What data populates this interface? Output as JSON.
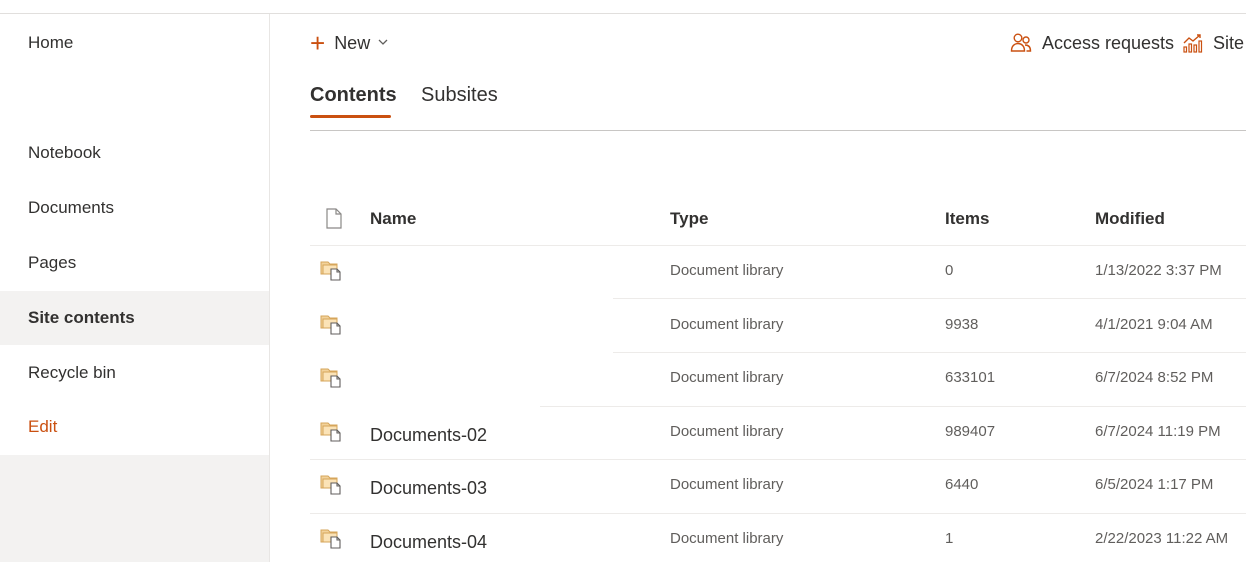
{
  "left_nav": {
    "items": [
      {
        "label": "Home"
      },
      {
        "label": "Notebook"
      },
      {
        "label": "Documents"
      },
      {
        "label": "Pages"
      },
      {
        "label": "Site contents"
      },
      {
        "label": "Recycle bin"
      },
      {
        "label": "Edit"
      }
    ]
  },
  "command_bar": {
    "new_label": "New",
    "access_requests_label": "Access requests",
    "site_label": "Site"
  },
  "tabs": [
    {
      "label": "Contents",
      "selected": true
    },
    {
      "label": "Subsites",
      "selected": false
    }
  ],
  "table": {
    "columns": [
      "Name",
      "Type",
      "Items",
      "Modified"
    ],
    "rows": [
      {
        "name": "",
        "type": "Document library",
        "items": "0",
        "modified": "1/13/2022 3:37 PM"
      },
      {
        "name": "",
        "type": "Document library",
        "items": "9938",
        "modified": "4/1/2021 9:04 AM"
      },
      {
        "name": "",
        "type": "Document library",
        "items": "633101",
        "modified": "6/7/2024 8:52 PM"
      },
      {
        "name": "Documents-02",
        "type": "Document library",
        "items": "989407",
        "modified": "6/7/2024 11:19 PM"
      },
      {
        "name": "Documents-03",
        "type": "Document library",
        "items": "6440",
        "modified": "6/5/2024 1:17 PM"
      },
      {
        "name": "Documents-04",
        "type": "Document library",
        "items": "1",
        "modified": "2/22/2023 11:22 AM"
      }
    ]
  },
  "colors": {
    "accent": "#ca5010",
    "nav_selected_bg": "#f3f2f1",
    "text_primary": "#323130",
    "text_secondary": "#605e5c"
  }
}
